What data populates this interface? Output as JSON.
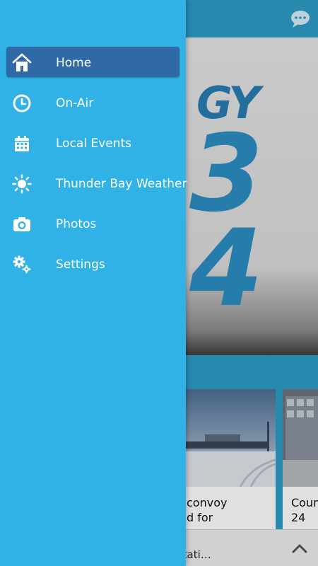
{
  "drawer": {
    "items": [
      {
        "label": "Home",
        "icon": "home-icon",
        "active": true
      },
      {
        "label": "On-Air",
        "icon": "clock-icon",
        "active": false
      },
      {
        "label": "Local Events",
        "icon": "calendar-icon",
        "active": false
      },
      {
        "label": "Thunder Bay Weather",
        "icon": "sun-icon",
        "active": false
      },
      {
        "label": "Photos",
        "icon": "camera-icon",
        "active": false
      },
      {
        "label": "Settings",
        "icon": "gears-icon",
        "active": false
      }
    ]
  },
  "background": {
    "hero_text": {
      "line1": "GY",
      "line2": "3",
      "line3": "4"
    },
    "cards": [
      {
        "line1": "convoy",
        "line2": "d for"
      },
      {
        "line1": "Coun",
        "line2": "24"
      }
    ],
    "player_title": "y's Hit Music Stati…"
  },
  "colors": {
    "drawer_bg": "#31b2e6",
    "active_item_bg": "#2f6aa6",
    "app_bar": "#2e9cc6"
  }
}
